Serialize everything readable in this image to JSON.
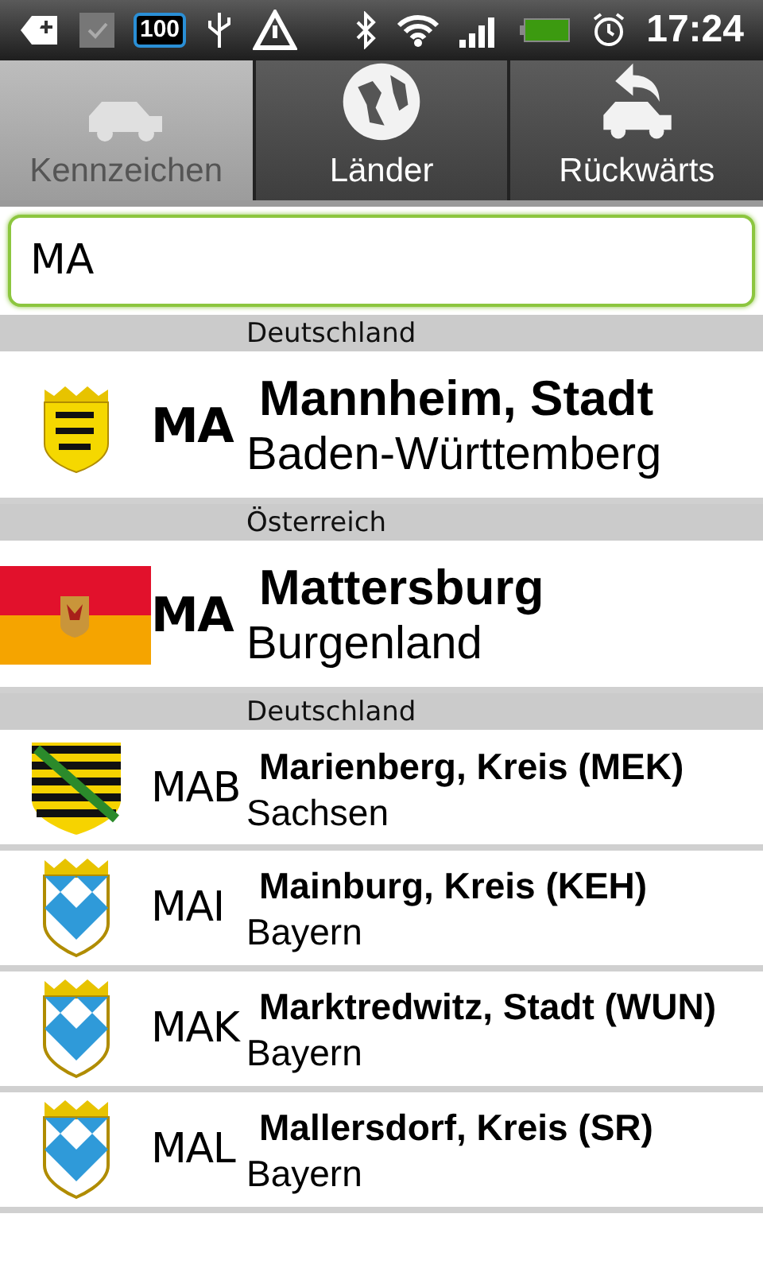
{
  "status_bar": {
    "battery_badge": "100",
    "time": "17:24"
  },
  "tabs": [
    {
      "label": "Kennzeichen",
      "selected": true
    },
    {
      "label": "Länder",
      "selected": false
    },
    {
      "label": "Rückwärts",
      "selected": false
    }
  ],
  "search": {
    "value": "MA"
  },
  "sections": [
    {
      "label": "Deutschland",
      "rows": [
        {
          "kind": "lions",
          "exact": true,
          "code": "MA",
          "name": "Mannheim, Stadt",
          "region": "Baden-Württemberg"
        }
      ]
    },
    {
      "label": "Österreich",
      "rows": [
        {
          "kind": "flag",
          "exact": true,
          "code": "MA",
          "name": "Mattersburg",
          "region": "Burgenland"
        }
      ]
    },
    {
      "label": "Deutschland",
      "rows": [
        {
          "kind": "stripes",
          "exact": false,
          "code": "MAB",
          "name": "Marienberg, Kreis (MEK)",
          "region": "Sachsen"
        },
        {
          "kind": "lozenges",
          "exact": false,
          "code": "MAI",
          "name": "Mainburg, Kreis (KEH)",
          "region": "Bayern"
        },
        {
          "kind": "lozenges",
          "exact": false,
          "code": "MAK",
          "name": "Marktredwitz, Stadt (WUN)",
          "region": "Bayern"
        },
        {
          "kind": "lozenges",
          "exact": false,
          "code": "MAL",
          "name": "Mallersdorf, Kreis (SR)",
          "region": "Bayern"
        }
      ]
    }
  ]
}
